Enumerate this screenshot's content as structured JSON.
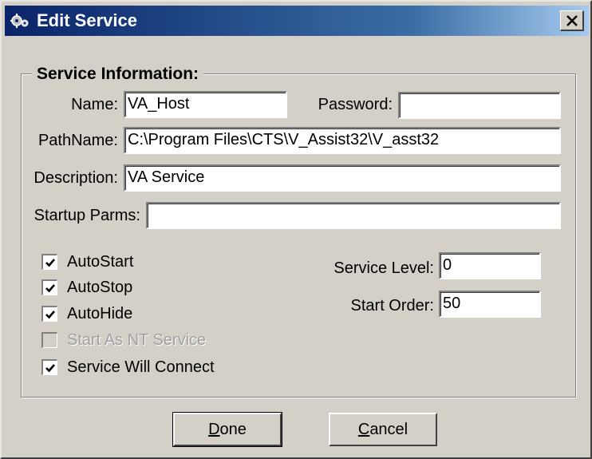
{
  "window": {
    "title": "Edit Service",
    "close_symbol": "X"
  },
  "group": {
    "legend": "Service Information:"
  },
  "fields": {
    "name": {
      "label": "Name:",
      "value": "VA_Host"
    },
    "password": {
      "label": "Password:",
      "value": ""
    },
    "pathname": {
      "label": "PathName:",
      "value": "C:\\Program Files\\CTS\\V_Assist32\\V_asst32"
    },
    "description": {
      "label": "Description:",
      "value": "VA Service"
    },
    "startup_parms": {
      "label": "Startup Parms:",
      "value": ""
    },
    "service_level": {
      "label": "Service Level:",
      "value": "0"
    },
    "start_order": {
      "label": "Start Order:",
      "value": "50"
    }
  },
  "checkboxes": [
    {
      "label": "AutoStart",
      "checked": true,
      "enabled": true
    },
    {
      "label": "AutoStop",
      "checked": true,
      "enabled": true
    },
    {
      "label": "AutoHide",
      "checked": true,
      "enabled": true
    },
    {
      "label": "Start As NT Service",
      "checked": false,
      "enabled": false
    },
    {
      "label": "Service Will Connect",
      "checked": true,
      "enabled": true
    }
  ],
  "buttons": {
    "done": {
      "mnemonic": "D",
      "rest": "one"
    },
    "cancel": {
      "mnemonic": "C",
      "rest": "ancel"
    }
  },
  "icons": {
    "title": "gear-app-icon",
    "close": "close-icon",
    "check": "checkmark-icon"
  },
  "colors": {
    "titlebar_start": "#0a246a",
    "titlebar_end": "#a6caf0",
    "face": "#d4d0c8"
  }
}
